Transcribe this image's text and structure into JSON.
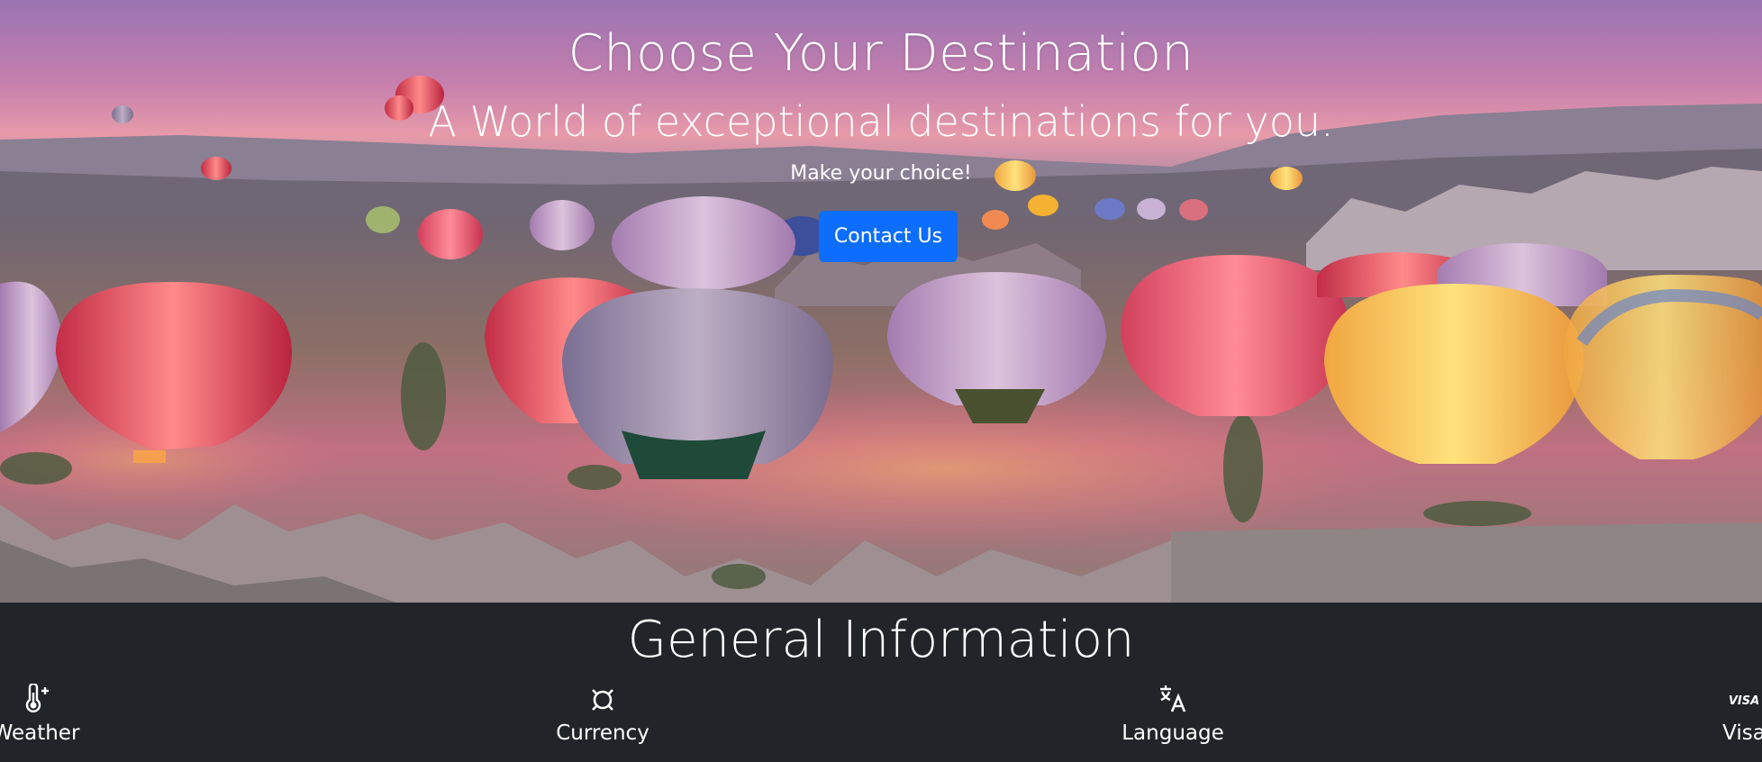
{
  "hero": {
    "title": "Choose Your Destination",
    "subtitle": "A World of exceptional destinations for you.",
    "lead": "Make your choice!",
    "button_label": "Contact Us"
  },
  "info": {
    "title": "General Information",
    "items": [
      {
        "label": "Weather",
        "icon": "thermometer-plus-icon"
      },
      {
        "label": "Currency",
        "icon": "currency-icon"
      },
      {
        "label": "Language",
        "icon": "translate-icon"
      },
      {
        "label": "Visa",
        "icon": "visa-icon"
      }
    ]
  },
  "colors": {
    "button": "#0d6efd",
    "section_bg": "#212529",
    "text": "#ffffff"
  }
}
